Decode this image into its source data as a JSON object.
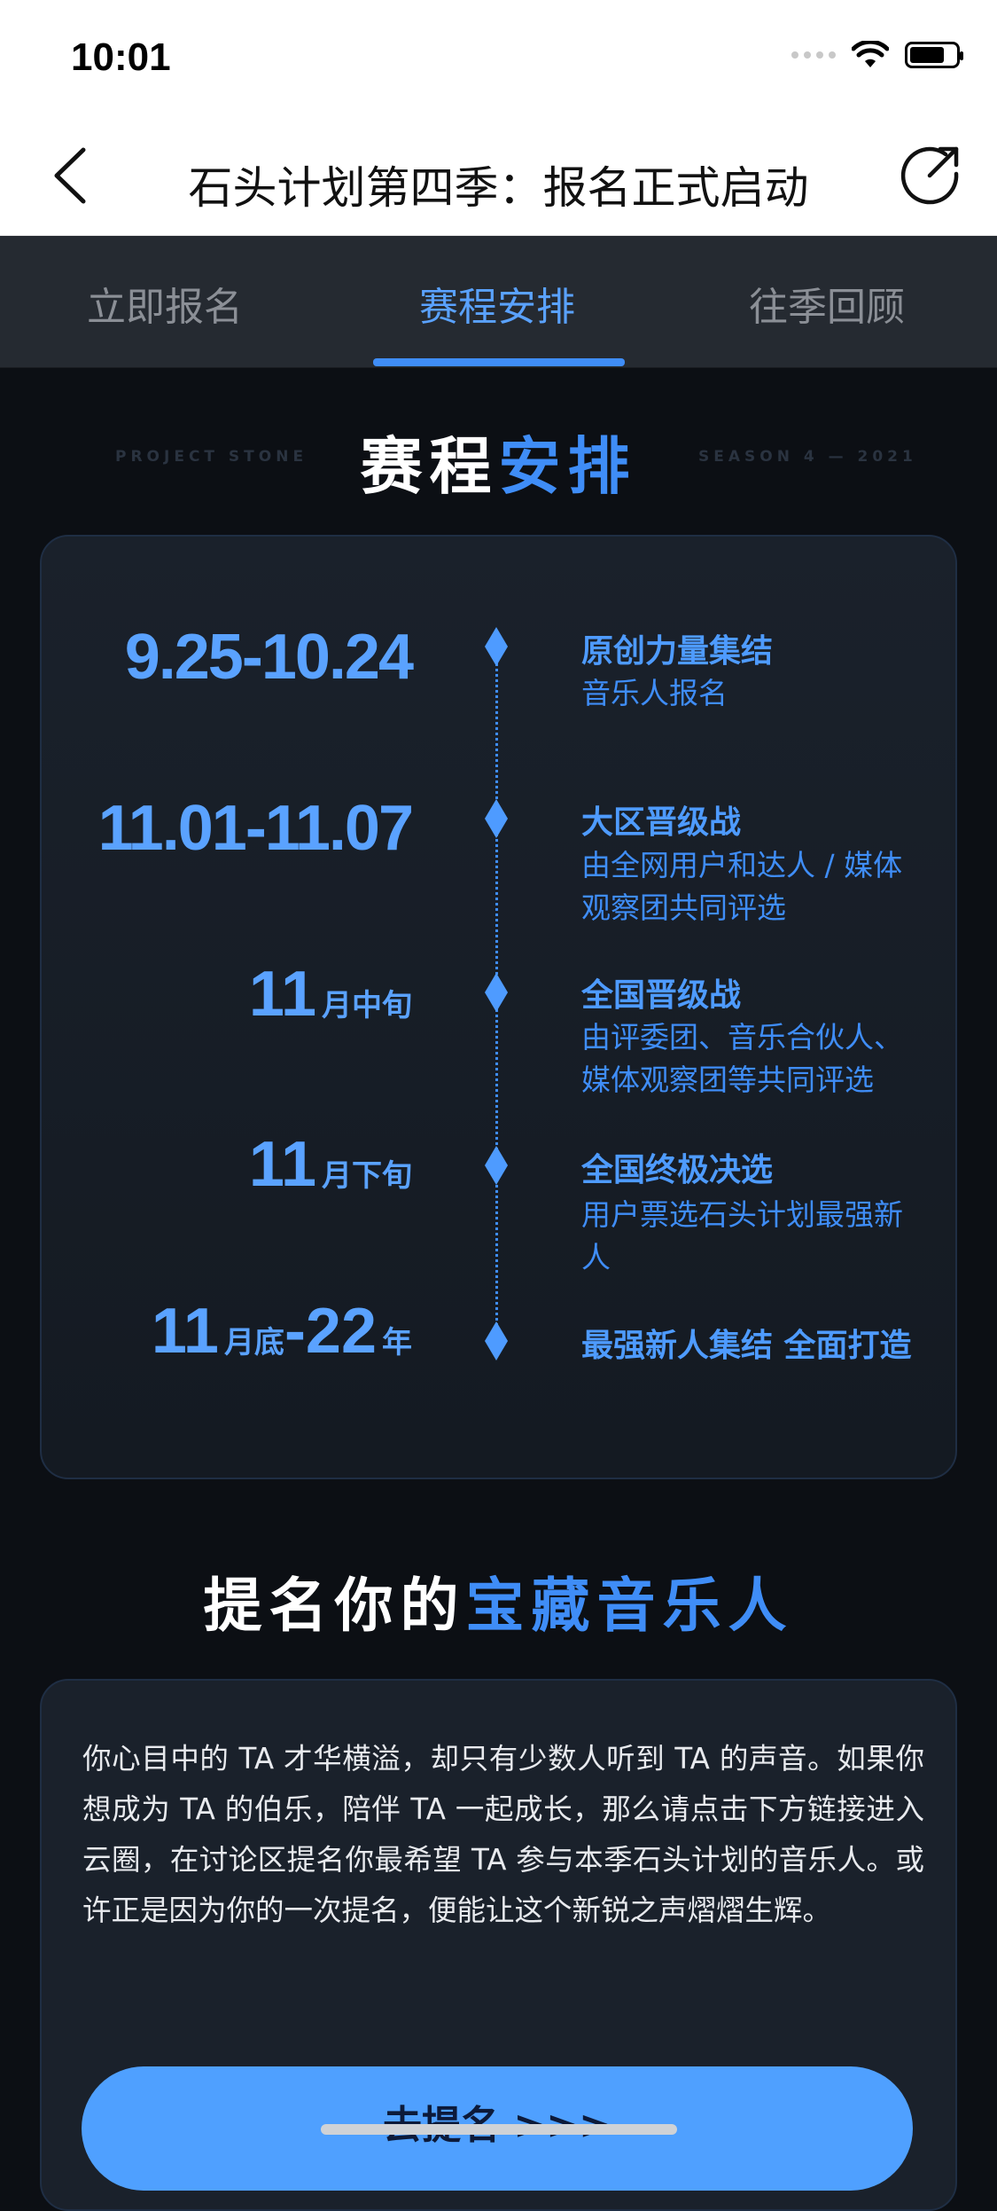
{
  "status_bar": {
    "time": "10:01",
    "battery_level": 0.75
  },
  "nav": {
    "title": "石头计划第四季：报名正式启动"
  },
  "tabs": [
    {
      "label": "立即报名",
      "active": false
    },
    {
      "label": "赛程安排",
      "active": true
    },
    {
      "label": "往季回顾",
      "active": false
    }
  ],
  "schedule": {
    "title_white": "赛程",
    "title_blue": "安排",
    "left_caption": "PROJECT STONE",
    "right_caption": "SEASON 4 — 2021",
    "items": [
      {
        "date": "9.25-10.24",
        "title": "原创力量集结",
        "desc": "音乐人报名"
      },
      {
        "date": "11.01-11.07",
        "title": "大区晋级战",
        "desc": "由全网用户和达人 / 媒体观察团共同评选"
      },
      {
        "date_num": "11",
        "date_suffix": "月中旬",
        "title": "全国晋级战",
        "desc": "由评委团、音乐合伙人、媒体观察团等共同评选"
      },
      {
        "date_num": "11",
        "date_suffix": "月下旬",
        "title": "全国终极决选",
        "desc": "用户票选石头计划最强新人"
      },
      {
        "date_num": "11",
        "date_mid": "月底",
        "date_num2": "-22",
        "date_suffix": "年",
        "title": "最强新人集结 全面打造",
        "desc": ""
      }
    ]
  },
  "nominate": {
    "title_white": "提名你的",
    "title_blue": "宝藏音乐人",
    "body": "你心目中的 TA 才华横溢，却只有少数人听到 TA 的声音。如果你想成为 TA 的伯乐，陪伴 TA 一起成长，那么请点击下方链接进入云圈，在讨论区提名你最希望 TA 参与本季石头计划的音乐人。或许正是因为你的一次提名，便能让这个新锐之声熠熠生辉。",
    "button_label": "去提名 >>>"
  },
  "colors": {
    "accent": "#3f8df7",
    "background": "#0c0f14",
    "card": "#1a212b"
  }
}
